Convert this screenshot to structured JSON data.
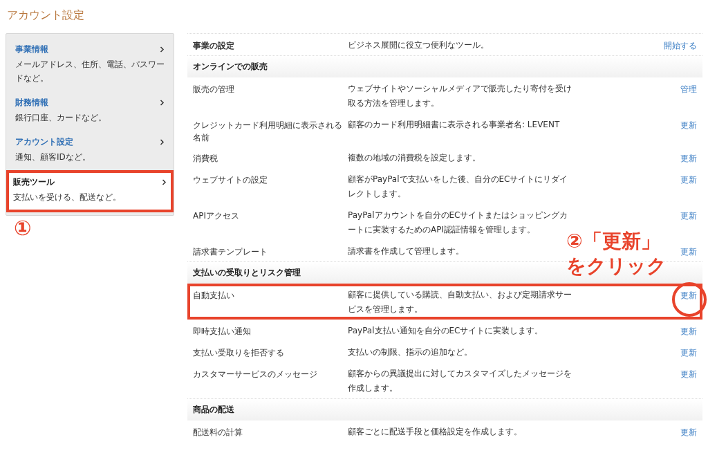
{
  "page_title": "アカウント設定",
  "sidebar": {
    "items": [
      {
        "title": "事業情報",
        "subtitle": "メールアドレス、住所、電話、パスワードなど。",
        "selected": false,
        "highlighted": false
      },
      {
        "title": "財務情報",
        "subtitle": "銀行口座、カードなど。",
        "selected": false,
        "highlighted": false
      },
      {
        "title": "アカウント設定",
        "subtitle": "通知、顧客IDなど。",
        "selected": false,
        "highlighted": false
      },
      {
        "title": "販売ツール",
        "subtitle": "支払いを受ける、配送など。",
        "selected": true,
        "highlighted": true
      }
    ]
  },
  "callout_1": "①",
  "top_row": {
    "label": "事業の設定",
    "description": "ビジネス展開に役立つ便利なツール。",
    "action": "開始する"
  },
  "sections": [
    {
      "title": "オンラインでの販売",
      "rows": [
        {
          "label": "販売の管理",
          "description": "ウェブサイトやソーシャルメディアで販売したり寄付を受け取る方法を管理します。",
          "action": "管理",
          "highlighted": false
        },
        {
          "label": "クレジットカード利用明細に表示される名前",
          "description": "顧客のカード利用明細書に表示される事業者名: LEVENT",
          "action": "更新",
          "highlighted": false
        },
        {
          "label": "消費税",
          "description": "複数の地域の消費税を設定します。",
          "action": "更新",
          "highlighted": false
        },
        {
          "label": "ウェブサイトの設定",
          "description": "顧客がPayPalで支払いをした後、自分のECサイトにリダイレクトします。",
          "action": "更新",
          "highlighted": false
        },
        {
          "label": "APIアクセス",
          "description": "PayPalアカウントを自分のECサイトまたはショッピングカートに実装するためのAPI認証情報を管理します。",
          "action": "更新",
          "highlighted": false
        },
        {
          "label": "請求書テンプレート",
          "description": "請求書を作成して管理します。",
          "action": "更新",
          "highlighted": false
        }
      ]
    },
    {
      "title": "支払いの受取りとリスク管理",
      "rows": [
        {
          "label": "自動支払い",
          "description": "顧客に提供している購読、自動支払い、および定期請求サービスを管理します。",
          "action": "更新",
          "highlighted": true
        },
        {
          "label": "即時支払い通知",
          "description": "PayPal支払い通知を自分のECサイトに実装します。",
          "action": "更新",
          "highlighted": false
        },
        {
          "label": "支払い受取りを拒否する",
          "description": "支払いの制限、指示の追加など。",
          "action": "更新",
          "highlighted": false
        },
        {
          "label": "カスタマーサービスのメッセージ",
          "description": "顧客からの異議提出に対してカスタマイズしたメッセージを作成します。",
          "action": "更新",
          "highlighted": false
        }
      ]
    },
    {
      "title": "商品の配送",
      "rows": [
        {
          "label": "配送料の計算",
          "description": "顧客ごとに配送手段と価格設定を作成します。",
          "action": "更新",
          "highlighted": false
        }
      ]
    }
  ],
  "callout_2": {
    "lines": [
      "②「更新」",
      "をクリック"
    ]
  }
}
